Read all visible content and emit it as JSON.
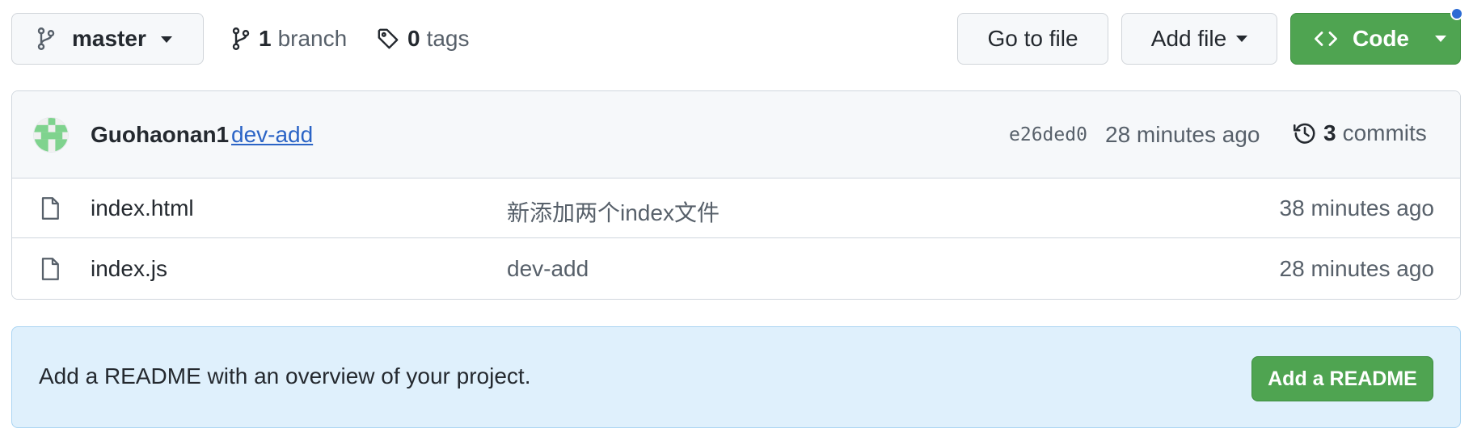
{
  "toolbar": {
    "branch": {
      "label": "master",
      "icon": "git-branch-icon"
    },
    "branches": {
      "count": "1",
      "label": "branch",
      "icon": "git-branch-icon"
    },
    "tags": {
      "count": "0",
      "label": "tags",
      "icon": "tag-icon"
    },
    "goto_file": "Go to file",
    "add_file": "Add file",
    "code": {
      "label": "Code",
      "icon": "code-icon"
    }
  },
  "latest_commit": {
    "author": "Guohaonan1",
    "message": "dev-add",
    "sha": "e26ded0",
    "time": "28 minutes ago",
    "commits_count": "3",
    "commits_label": "commits",
    "icon": "history-icon"
  },
  "files": [
    {
      "name": "index.html",
      "message": "新添加两个index文件",
      "time": "38 minutes ago",
      "icon": "file-icon"
    },
    {
      "name": "index.js",
      "message": "dev-add",
      "time": "28 minutes ago",
      "icon": "file-icon"
    }
  ],
  "readme": {
    "text": "Add a README with an overview of your project.",
    "button": "Add a README"
  },
  "colors": {
    "primary_green": "#4fa451",
    "link_blue": "#2b64c6",
    "banner_bg": "#dff0fc",
    "notification_dot": "#2c6bd4"
  }
}
